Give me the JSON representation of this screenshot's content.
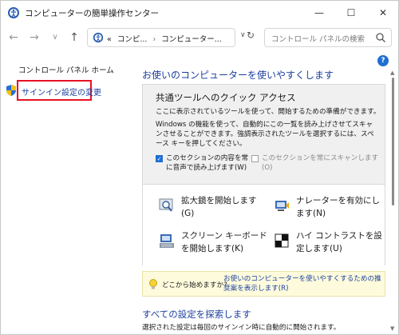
{
  "window": {
    "title": "コンピューターの簡単操作センター",
    "controls": {
      "minimize_icon": "minimize-icon",
      "maximize_icon": "maximize-icon",
      "close_icon": "close-icon"
    }
  },
  "nav": {
    "back_icon": "arrow-left-icon",
    "forward_icon": "arrow-right-icon",
    "recent_icon": "chevron-down-icon",
    "up_icon": "arrow-up-icon",
    "breadcrumb": [
      "«",
      "コンピ...",
      "コンピューター..."
    ],
    "search": {
      "placeholder": "コントロール パネルの検索"
    }
  },
  "left_pane": {
    "home_link": "コントロール パネル ホーム",
    "signin_link": "サインイン設定の変更",
    "highlight_color": "#e81123"
  },
  "main": {
    "heading": "お使いのコンピューターを使いやすくします",
    "quick_access": {
      "title": "共通ツールへのクイック アクセス",
      "description": "ここに表示されているツールを使って、開始するための準備ができます。",
      "info": "Windows の機能を使って、自動的にこの一覧を読み上げさせてスキャンさせることができます。強調表示されたツールを選択するには、スペース キーを押してください。",
      "checkbox_read": {
        "label": "このセクションの内容を常に音声で読み上げます(W)",
        "checked": true
      },
      "checkbox_scan": {
        "label": "このセクションを常にスキャンします(O)",
        "checked": false,
        "disabled": true
      },
      "tools": [
        {
          "label": "拡大鏡を開始します(G)",
          "icon": "magnifier-icon"
        },
        {
          "label": "ナレーターを有効にします(N)",
          "icon": "narrator-icon"
        },
        {
          "label": "スクリーン キーボードを開始します(K)",
          "icon": "on-screen-keyboard-icon"
        },
        {
          "label": "ハイ コントラストを設定します(U)",
          "icon": "high-contrast-icon"
        }
      ]
    },
    "tip": {
      "question": "どこから始めますか?",
      "link": "お使いのコンピューターを使いやすくするための推奨案を表示します(R)"
    },
    "explore": {
      "heading": "すべての設定を探索します",
      "subtitle": "選択された設定は毎回のサインイン時に自動的に開始されます。"
    }
  },
  "colors": {
    "link": "#1c3fa0",
    "accent": "#1f6fd1",
    "panel_bg": "#f0f0f0",
    "tip_bg": "#fdfbdc"
  }
}
